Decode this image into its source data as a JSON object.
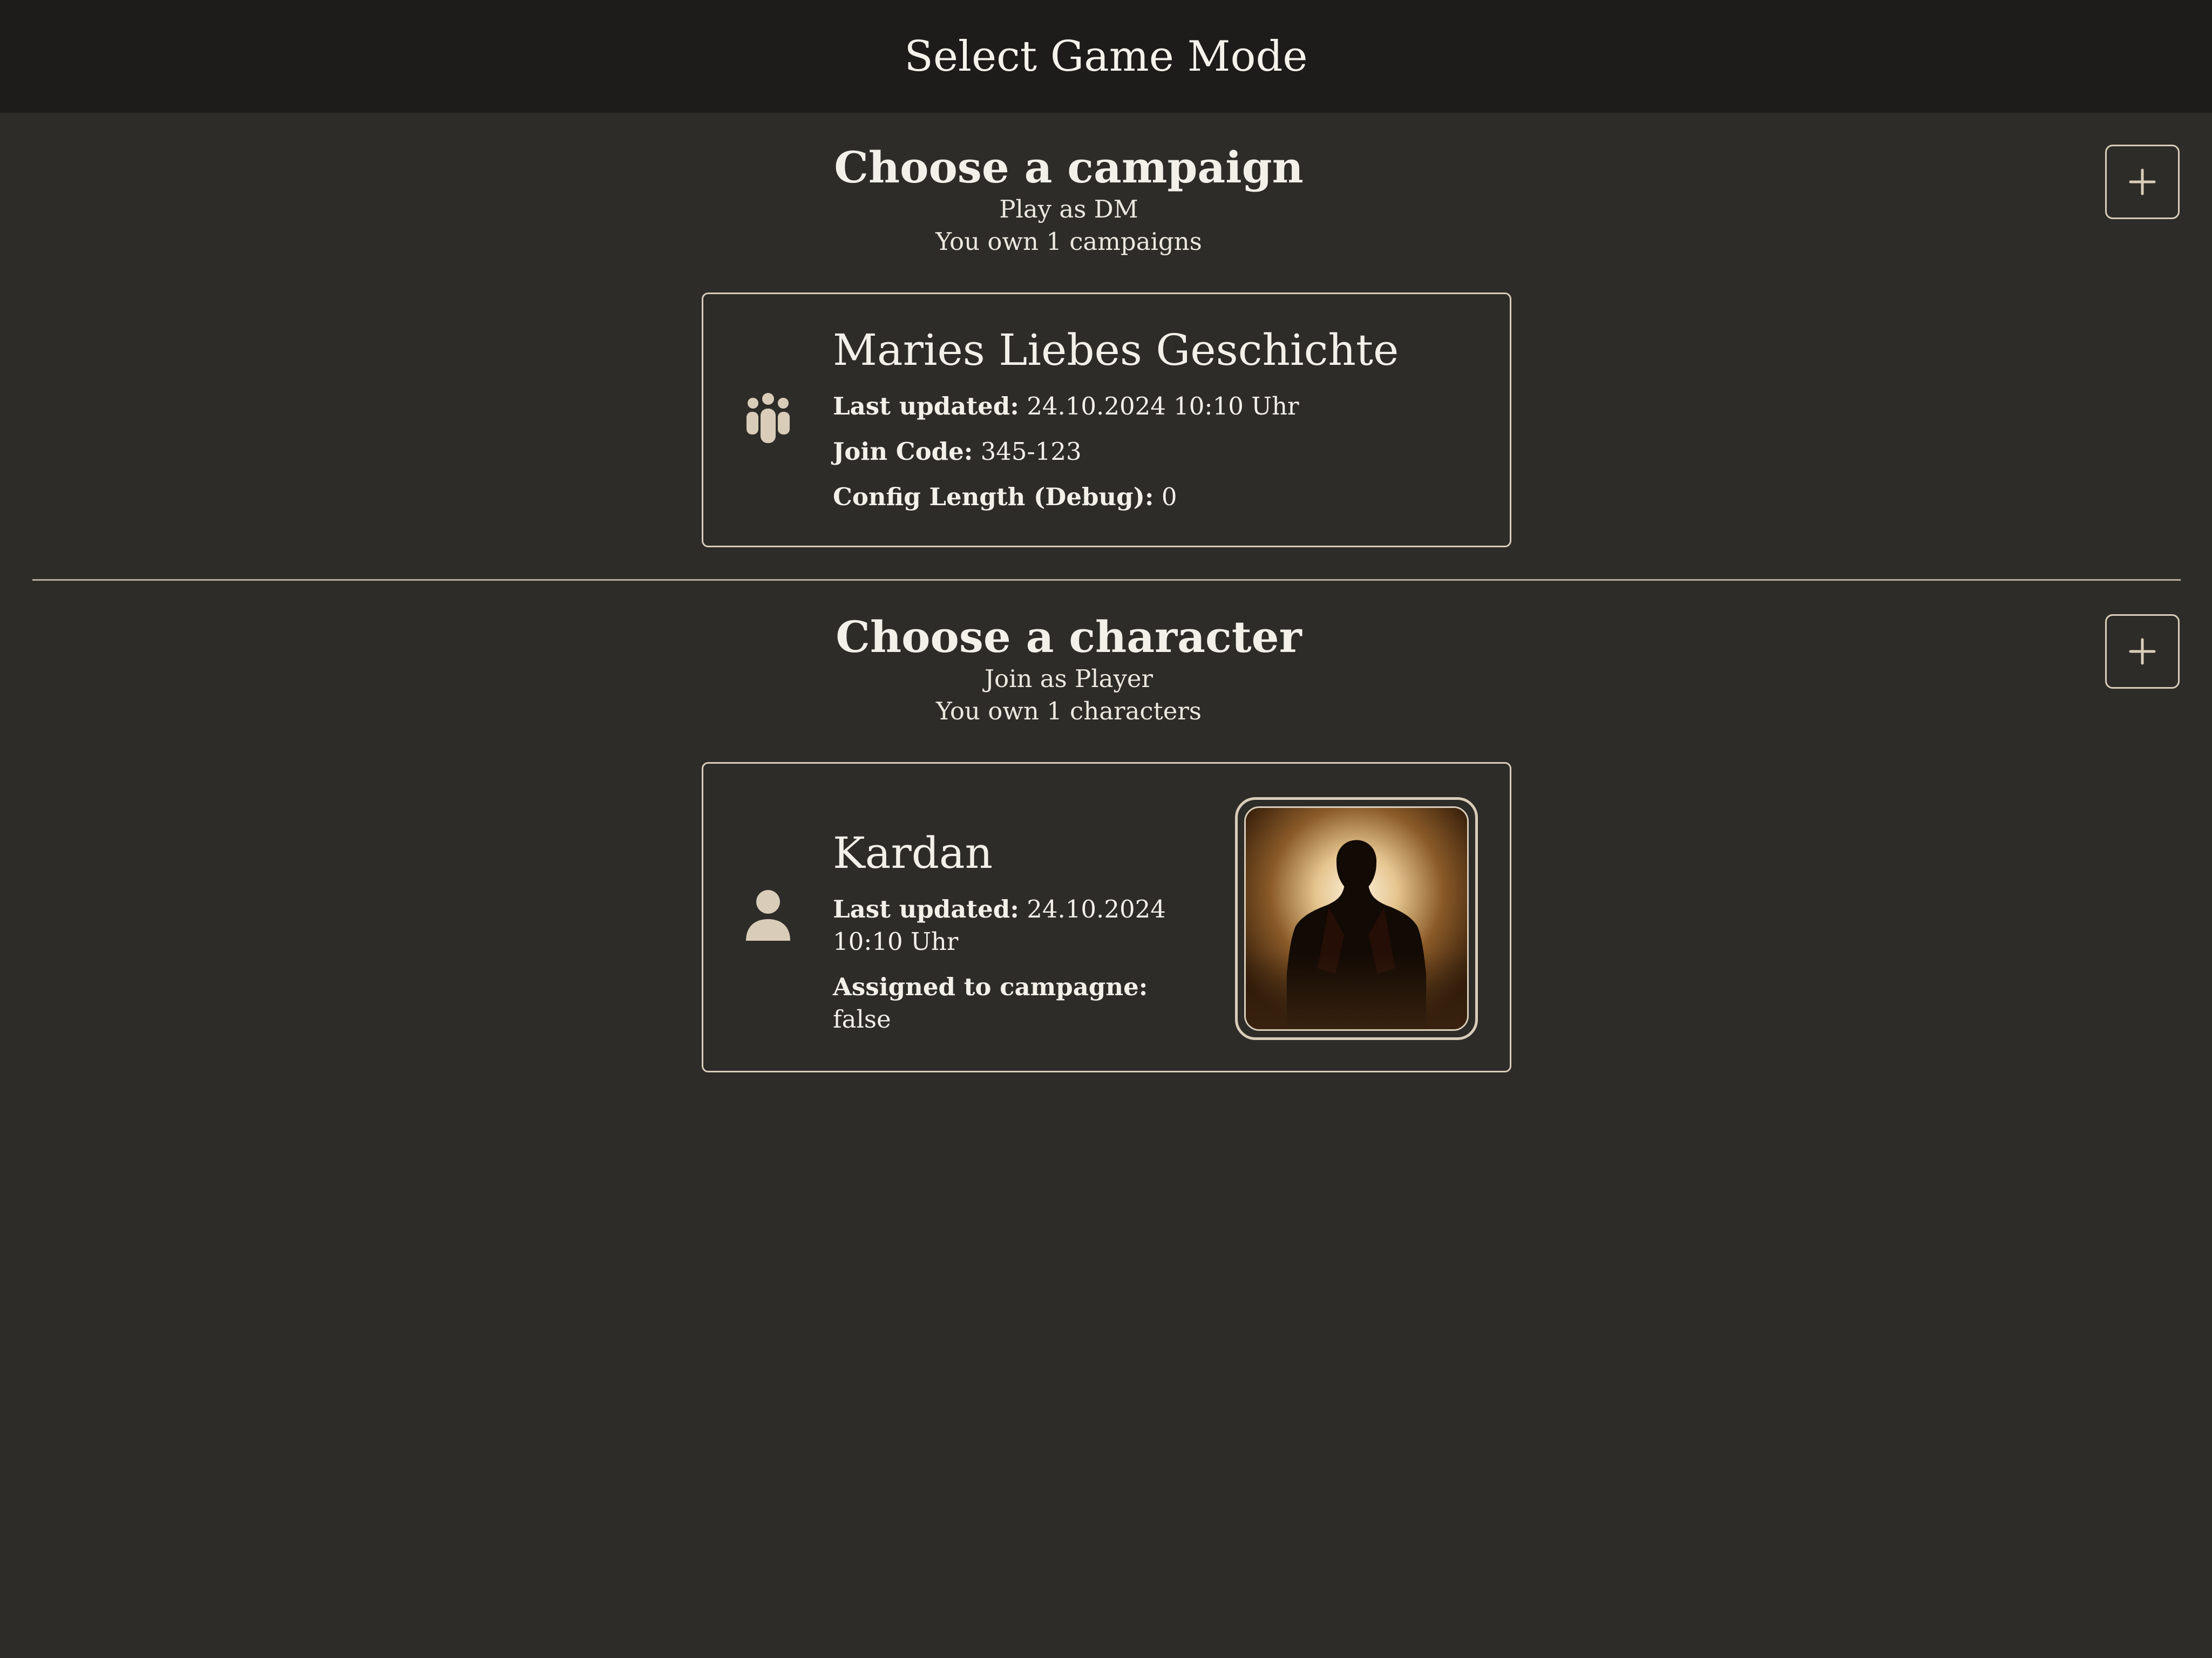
{
  "header": {
    "title": "Select Game Mode"
  },
  "campaigns": {
    "title": "Choose a campaign",
    "subtitle": "Play as DM",
    "count_text": "You own 1 campaigns",
    "add_icon": "plus-icon",
    "items": [
      {
        "icon": "group-icon",
        "name": "Maries Liebes Geschichte",
        "last_updated_label": "Last updated:",
        "last_updated_value": "24.10.2024 10:10 Uhr",
        "join_code_label": "Join Code:",
        "join_code_value": "345-123",
        "config_length_label": "Config Length (Debug):",
        "config_length_value": "0"
      }
    ]
  },
  "characters": {
    "title": "Choose a character",
    "subtitle": "Join as Player",
    "count_text": "You own 1 characters",
    "add_icon": "plus-icon",
    "items": [
      {
        "icon": "person-icon",
        "name": "Kardan",
        "last_updated_label": "Last updated:",
        "last_updated_value": "24.10.2024 10:10 Uhr",
        "assigned_label": "Assigned to campagne:",
        "assigned_value": "false",
        "portrait": "character-portrait"
      }
    ]
  },
  "colors": {
    "background": "#2d2c29",
    "topbar": "#1d1c1a",
    "accent": "#d9cdb9",
    "text": "#f3f0ea"
  }
}
